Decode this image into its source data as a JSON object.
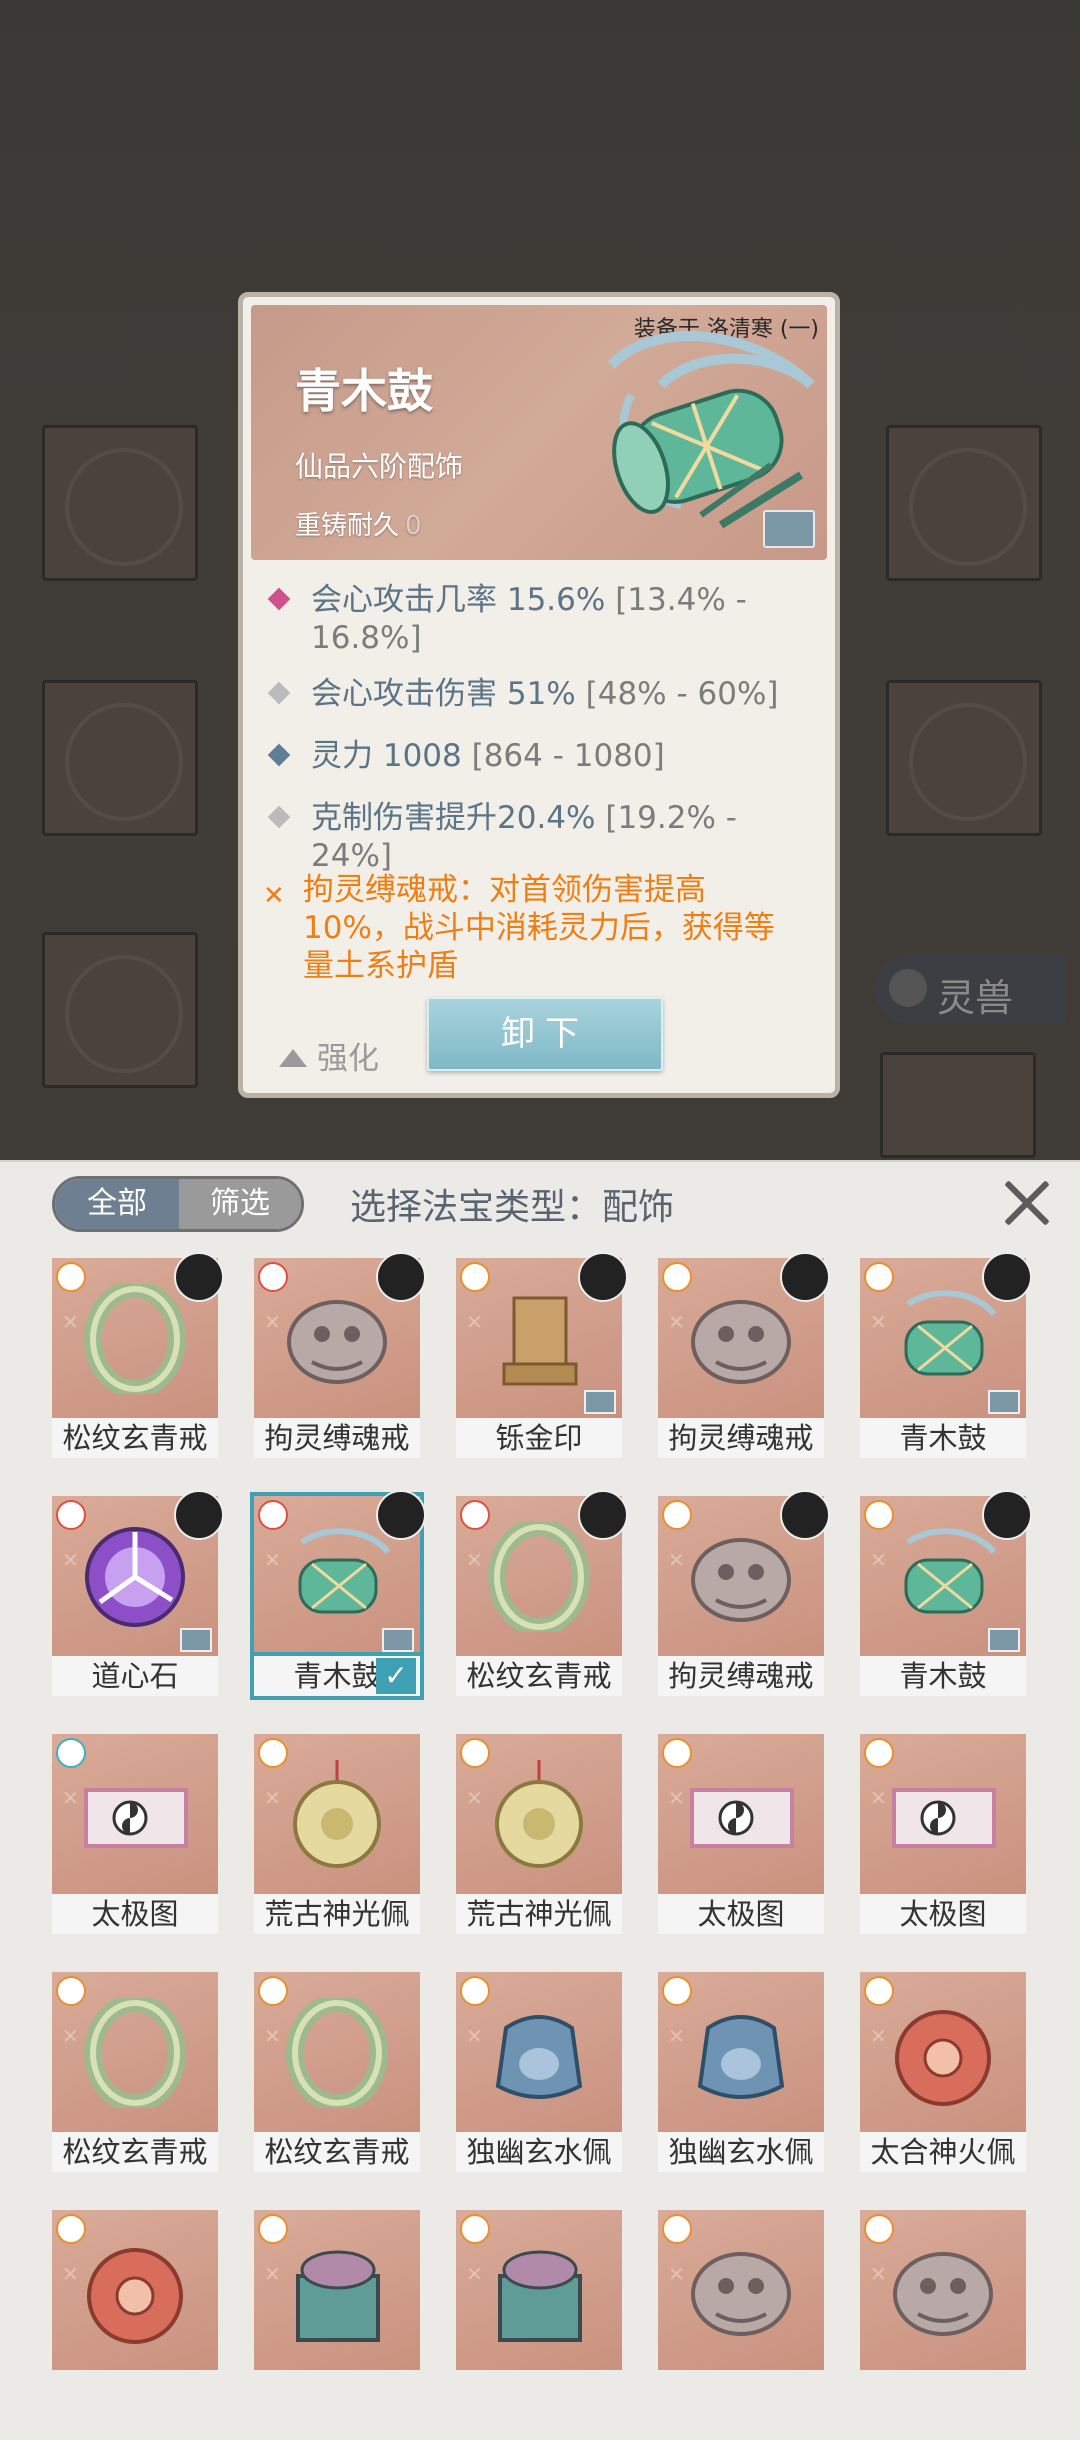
{
  "detail": {
    "equipped_on": "装备于 洛清寒 (一)",
    "name": "青木鼓",
    "rank": "仙品六阶配饰",
    "recast_label": "重铸耐久",
    "recast_value": "0",
    "stats": [
      {
        "text": "会心攻击几率 15.6%",
        "range": "[13.4% - 16.8%]",
        "color": "#d0508a"
      },
      {
        "text": "会心攻击伤害 51%",
        "range": "[48% - 60%]",
        "color": "#bbbbbb"
      },
      {
        "text": "灵力 1008",
        "range": "[864 - 1080]",
        "color": "#5f7d96"
      },
      {
        "text": "克制伤害提升20.4%",
        "range": "[19.2% - 24%]",
        "color": "#bbbbbb"
      }
    ],
    "skill_text": "拘灵缚魂戒：对首领伤害提高10%，战斗中消耗灵力后，获得等量土系护盾",
    "enhance_label": "强化",
    "unequip_label": "卸下"
  },
  "background": {
    "beast_tab": "灵兽"
  },
  "panel": {
    "tab_all": "全部",
    "tab_filter": "筛选",
    "title": "选择法宝类型：配饰"
  },
  "items": [
    {
      "name": "松纹玄青戒",
      "art": "ring-green",
      "avatar": true,
      "tag": false,
      "badge": "orange"
    },
    {
      "name": "拘灵缚魂戒",
      "art": "beast-ring",
      "avatar": true,
      "tag": false,
      "badge": "red"
    },
    {
      "name": "铄金印",
      "art": "seal-gold",
      "avatar": true,
      "tag": true,
      "badge": "orange"
    },
    {
      "name": "拘灵缚魂戒",
      "art": "beast-ring",
      "avatar": true,
      "tag": false,
      "badge": "orange"
    },
    {
      "name": "青木鼓",
      "art": "drum-green",
      "avatar": true,
      "tag": true,
      "badge": "orange"
    },
    {
      "name": "道心石",
      "art": "orb-purple",
      "avatar": true,
      "tag": true,
      "badge": "red"
    },
    {
      "name": "青木鼓",
      "art": "drum-green",
      "avatar": true,
      "tag": true,
      "badge": "red",
      "selected": true
    },
    {
      "name": "松纹玄青戒",
      "art": "ring-green",
      "avatar": true,
      "tag": false,
      "badge": "red"
    },
    {
      "name": "拘灵缚魂戒",
      "art": "beast-ring",
      "avatar": true,
      "tag": false,
      "badge": "orange"
    },
    {
      "name": "青木鼓",
      "art": "drum-green",
      "avatar": true,
      "tag": true,
      "badge": "orange"
    },
    {
      "name": "太极图",
      "art": "scroll-taiji",
      "avatar": false,
      "tag": false,
      "badge": "teal"
    },
    {
      "name": "荒古神光佩",
      "art": "pendant-gold",
      "avatar": false,
      "tag": false,
      "badge": "orange"
    },
    {
      "name": "荒古神光佩",
      "art": "pendant-gold",
      "avatar": false,
      "tag": false,
      "badge": "orange"
    },
    {
      "name": "太极图",
      "art": "scroll-taiji",
      "avatar": false,
      "tag": false,
      "badge": "orange"
    },
    {
      "name": "太极图",
      "art": "scroll-taiji",
      "avatar": false,
      "tag": false,
      "badge": "orange"
    },
    {
      "name": "松纹玄青戒",
      "art": "ring-green",
      "avatar": false,
      "tag": false,
      "badge": "orange"
    },
    {
      "name": "松纹玄青戒",
      "art": "ring-green",
      "avatar": false,
      "tag": false,
      "badge": "orange"
    },
    {
      "name": "独幽玄水佩",
      "art": "jar-blue",
      "avatar": false,
      "tag": false,
      "badge": "orange"
    },
    {
      "name": "独幽玄水佩",
      "art": "jar-blue",
      "avatar": false,
      "tag": false,
      "badge": "orange"
    },
    {
      "name": "太合神火佩",
      "art": "pendant-red",
      "avatar": false,
      "tag": false,
      "badge": "orange"
    },
    {
      "name": "",
      "art": "pendant-red",
      "avatar": false,
      "tag": false,
      "badge": "orange"
    },
    {
      "name": "",
      "art": "bronze-vessel",
      "avatar": false,
      "tag": false,
      "badge": "orange"
    },
    {
      "name": "",
      "art": "bronze-vessel",
      "avatar": false,
      "tag": false,
      "badge": "orange"
    },
    {
      "name": "",
      "art": "beast-ring",
      "avatar": false,
      "tag": false,
      "badge": "orange"
    },
    {
      "name": "",
      "art": "beast-ring",
      "avatar": false,
      "tag": false,
      "badge": "orange"
    }
  ]
}
